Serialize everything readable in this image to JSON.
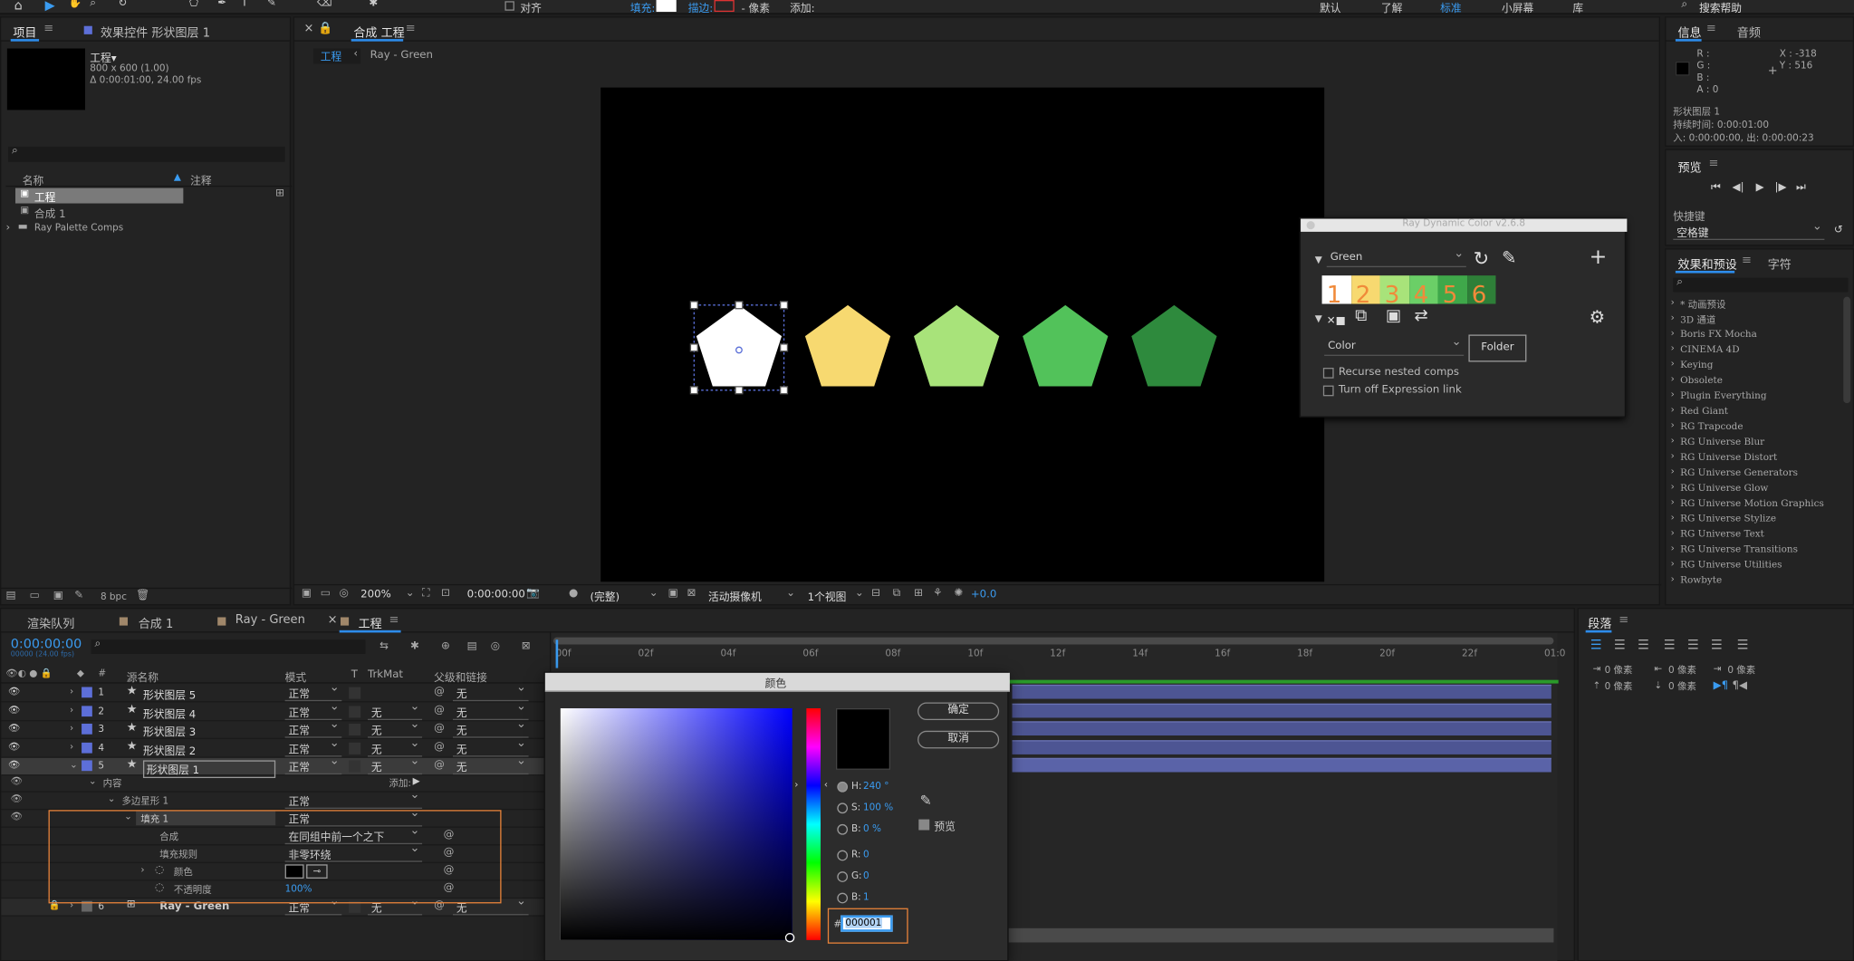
{
  "toolbar": {
    "align_label": "对齐",
    "fill_label": "填充:",
    "stroke_label": "描边:",
    "stroke_px": "- 像素",
    "add_label": "添加:",
    "workspaces": [
      "默认",
      "了解",
      "标准",
      "小屏幕",
      "库"
    ],
    "search_placeholder": "搜索帮助"
  },
  "project": {
    "tab": "项目",
    "effects_tab": "效果控件 形状图层 1",
    "item_name": "工程▾",
    "item_size": "800 x 600 (1.00)",
    "item_duration": "Δ 0:00:01:00, 24.00 fps",
    "col_name": "名称",
    "col_note": "注释",
    "items": [
      "工程",
      "合成 1",
      "Ray Palette Comps"
    ],
    "bpc": "8 bpc"
  },
  "comp": {
    "tab": "合成 工程",
    "crumbs": [
      "工程",
      "Ray - Green"
    ],
    "zoom": "200%",
    "time": "0:00:00:00",
    "quality": "(完整)",
    "camera": "活动摄像机",
    "views": "1个视图",
    "exposure": "+0.0"
  },
  "shapes": [
    {
      "color": "#ffffff"
    },
    {
      "color": "#f7d970"
    },
    {
      "color": "#a8e37a"
    },
    {
      "color": "#52c25a"
    },
    {
      "color": "#2e8a3d"
    }
  ],
  "ray": {
    "title": "Ray Dynamic Color v2.6.8",
    "palette": "Green",
    "numbers": [
      "1",
      "2",
      "3",
      "4",
      "5",
      "6"
    ],
    "swatches": [
      "#ffffff",
      "#f7d970",
      "#a8e37a",
      "#6bcf67",
      "#3fa84a",
      "#2e7f38"
    ],
    "type": "Color",
    "folder_btn": "Folder",
    "recurse": "Recurse nested comps",
    "turnoff": "Turn off Expression link"
  },
  "info": {
    "tab": "信息",
    "audio_tab": "音频",
    "r": "R :",
    "g": "G :",
    "b": "B :",
    "a": "A : 0",
    "x": "X : -318",
    "y": "Y : 516",
    "layer": "形状图层 1",
    "duration": "持续时间: 0:00:01:00",
    "inout": "入: 0:00:00:00,  出: 0:00:00:23",
    "preview_tab": "预览",
    "shortcut": "快捷键",
    "shortcut_val": "空格键"
  },
  "effects": {
    "tab": "效果和预设",
    "char_tab": "字符",
    "items": [
      "* 动画预设",
      "3D 通道",
      "Boris FX Mocha",
      "CINEMA 4D",
      "Keying",
      "Obsolete",
      "Plugin Everything",
      "Red Giant",
      "RG Trapcode",
      "RG Universe Blur",
      "RG Universe Distort",
      "RG Universe Generators",
      "RG Universe Glow",
      "RG Universe Motion Graphics",
      "RG Universe Stylize",
      "RG Universe Text",
      "RG Universe Transitions",
      "RG Universe Utilities",
      "Rowbyte"
    ]
  },
  "timeline": {
    "tabs": [
      "渲染队列",
      "合成 1",
      "Ray - Green",
      "工程"
    ],
    "time": "0:00:00:00",
    "time_sub": "00000 (24.00 fps)",
    "col_src": "源名称",
    "col_mode": "模式",
    "col_t": "T",
    "col_trk": "TrkMat",
    "col_parent": "父级和链接",
    "ticks": [
      "00f",
      "02f",
      "04f",
      "06f",
      "08f",
      "10f",
      "12f",
      "14f",
      "16f",
      "18f",
      "20f",
      "22f",
      "01:0"
    ],
    "layers": [
      {
        "num": "1",
        "name": "形状图层 5",
        "mode": "正常",
        "trk": "",
        "parent": "无"
      },
      {
        "num": "2",
        "name": "形状图层 4",
        "mode": "正常",
        "trk": "无",
        "parent": "无"
      },
      {
        "num": "3",
        "name": "形状图层 3",
        "mode": "正常",
        "trk": "无",
        "parent": "无"
      },
      {
        "num": "4",
        "name": "形状图层 2",
        "mode": "正常",
        "trk": "无",
        "parent": "无"
      },
      {
        "num": "5",
        "name": "形状图层 1",
        "mode": "正常",
        "trk": "无",
        "parent": "无"
      }
    ],
    "contents": "内容",
    "add": "添加:",
    "polystar": "多边星形 1",
    "poly_mode": "正常",
    "fill": "填充 1",
    "fill_mode": "正常",
    "composite": "合成",
    "composite_val": "在同组中前一个之下",
    "fillrule": "填充规则",
    "fillrule_val": "非零环绕",
    "color": "颜色",
    "opacity": "不透明度",
    "opacity_val": "100%",
    "layer6": {
      "num": "6",
      "name": "Ray - Green",
      "mode": "正常",
      "trk": "无",
      "parent": "无"
    }
  },
  "paragraph": {
    "tab": "段落",
    "px": [
      "0 像素",
      "0 像素",
      "0 像素",
      "0 像素",
      "0 像素"
    ]
  },
  "colorpicker": {
    "title": "颜色",
    "ok": "确定",
    "cancel": "取消",
    "h_label": "H:",
    "h_val": "240 °",
    "s_label": "S:",
    "s_val": "100 %",
    "b_label": "B:",
    "b_val": "0 %",
    "r_label": "R:",
    "r_val": "0",
    "g_label": "G:",
    "g_val": "0",
    "bb_label": "B:",
    "bb_val": "1",
    "preview": "预览",
    "hex": "000001"
  }
}
